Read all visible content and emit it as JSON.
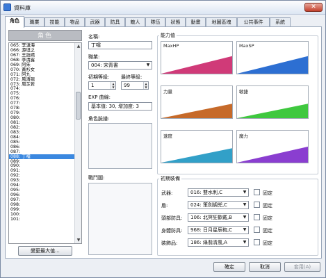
{
  "window": {
    "title": "資料庫",
    "close_glyph": "✕"
  },
  "tabs": [
    "角色",
    "職業",
    "技能",
    "物品",
    "武器",
    "防具",
    "敵人",
    "隊伍",
    "狀態",
    "動畫",
    "地圖區塊",
    "公共事件",
    "系統"
  ],
  "actor_list": {
    "header": "角色",
    "items": [
      "065: 李滄海",
      "066: 游坦之",
      "067: 王語嫣",
      "068: 李清露",
      "069: 阿朱",
      "070: 黃衫女",
      "071: 阿九",
      "072: 風清揚",
      "073: 周芷若",
      "074:",
      "075:",
      "076:",
      "077:",
      "078:",
      "079:",
      "080:",
      "081:",
      "082:",
      "083:",
      "084:",
      "085:",
      "086:",
      "087:",
      "088: 丁噹",
      "089:",
      "090:",
      "091:",
      "092:",
      "093:",
      "094:",
      "095:",
      "096:",
      "097:",
      "098:",
      "099:",
      "100:",
      "101:"
    ],
    "selected_index": 23,
    "max_button": "變更最大值..."
  },
  "form": {
    "name_label": "名稱:",
    "name_value": "丁噹",
    "class_label": "職業:",
    "class_value": "004: 宋青書",
    "initial_level_label": "初期等級:",
    "initial_level_value": "1",
    "final_level_label": "最終等級:",
    "final_level_value": "99",
    "exp_label": "EXP 曲線:",
    "exp_value": "基本值: 30, 增加度: 3",
    "graphic_label": "角色臉譜:",
    "battler_label": "戰鬥圖:"
  },
  "params": {
    "group_label": "能力值",
    "charts": [
      {
        "label": "MaxHP",
        "color": "#d03a78",
        "fill": 0.55
      },
      {
        "label": "MaxSP",
        "color": "#2d6fd2",
        "fill": 0.55
      },
      {
        "label": "力量",
        "color": "#c66a2a",
        "fill": 0.45
      },
      {
        "label": "敏捷",
        "color": "#3fc83f",
        "fill": 0.45
      },
      {
        "label": "速度",
        "color": "#32a0c8",
        "fill": 0.45
      },
      {
        "label": "魔力",
        "color": "#8a3ed0",
        "fill": 0.5
      }
    ]
  },
  "equipment": {
    "group_label": "初期裝備",
    "fixed_label": "固定",
    "rows": [
      {
        "label": "武器:",
        "value": "016: 雙水刺,C"
      },
      {
        "label": "盾:",
        "value": "024: 策劍綢兜,C"
      },
      {
        "label": "頭部防具:",
        "value": "106: 北冥狂歡戴,B"
      },
      {
        "label": "身體防具:",
        "value": "968: 日月星辰袍,C"
      },
      {
        "label": "裝飾品:",
        "value": "186: 綠翡清風,A"
      }
    ]
  },
  "footer": {
    "ok": "確定",
    "cancel": "取消",
    "apply": "套用(A)"
  }
}
